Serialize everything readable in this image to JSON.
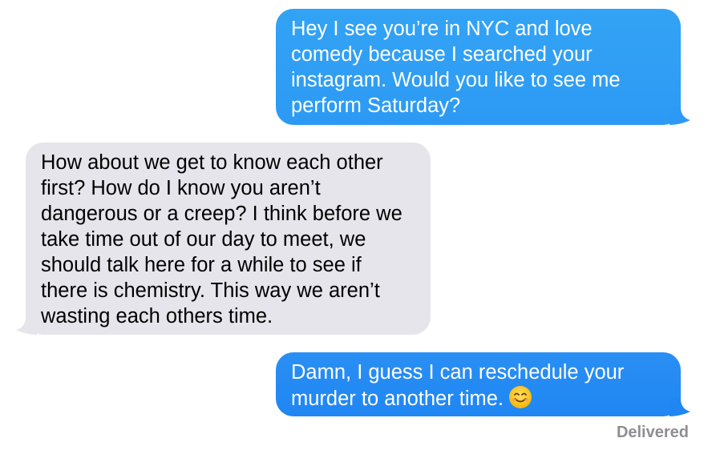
{
  "conversation": {
    "messages": [
      {
        "direction": "outgoing",
        "text": "Hey I see you’re in NYC and love comedy because I searched your instagram. Would you like to see me perform Saturday?"
      },
      {
        "direction": "incoming",
        "text": "How about we get to know each other first? How do I know you aren’t dangerous or a creep? I think before we take time out of our day to meet, we should talk here for a while to see if there is chemistry. This way we aren’t wasting each others time."
      },
      {
        "direction": "outgoing",
        "text": "Damn, I guess I can reschedule your murder to another time.",
        "emoji": "smiling-face-icon"
      }
    ],
    "status": "Delivered"
  },
  "colors": {
    "outgoing_bubble": "#2c9af4",
    "outgoing_bubble_last": "#1f86f3",
    "incoming_bubble": "#e6e5eb",
    "status_text": "#8e8e93"
  }
}
